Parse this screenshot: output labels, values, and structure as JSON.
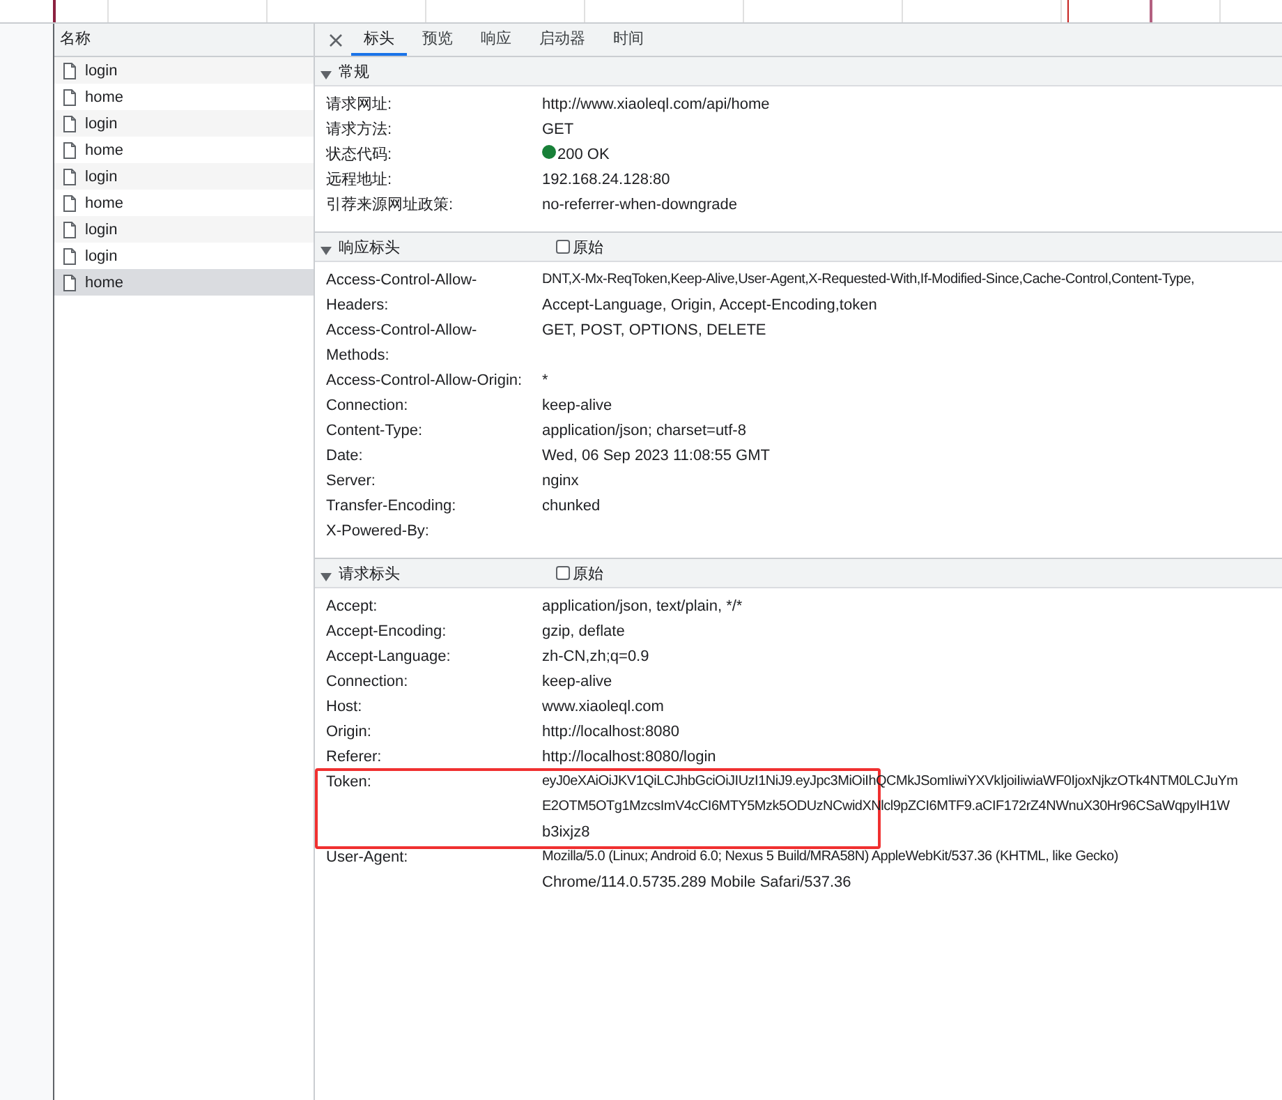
{
  "requests": {
    "header": "名称",
    "items": [
      {
        "name": "login",
        "selected": false
      },
      {
        "name": "home",
        "selected": false
      },
      {
        "name": "login",
        "selected": false
      },
      {
        "name": "home",
        "selected": false
      },
      {
        "name": "login",
        "selected": false
      },
      {
        "name": "home",
        "selected": false
      },
      {
        "name": "login",
        "selected": false
      },
      {
        "name": "login",
        "selected": false
      },
      {
        "name": "home",
        "selected": true
      }
    ]
  },
  "tabs": [
    {
      "label": "标头",
      "selected": true
    },
    {
      "label": "预览",
      "selected": false
    },
    {
      "label": "响应",
      "selected": false
    },
    {
      "label": "启动器",
      "selected": false
    },
    {
      "label": "时间",
      "selected": false
    }
  ],
  "sections": [
    {
      "title": "常规",
      "expanded": true,
      "rows": [
        {
          "name": "请求网址:",
          "lines": [
            "http://www.xiaoleql.com/api/home"
          ]
        },
        {
          "name": "请求方法:",
          "lines": [
            "GET"
          ]
        },
        {
          "name": "状态代码:",
          "lines": [
            "200 OK"
          ],
          "color": "#188038"
        },
        {
          "name": "远程地址:",
          "lines": [
            "192.168.24.128:80"
          ]
        },
        {
          "name": "引荐来源网址政策:",
          "lines": [
            "no-referrer-when-downgrade"
          ]
        }
      ]
    },
    {
      "title": "响应标头",
      "expanded": true,
      "raw": {
        "label": "原始",
        "checked": false
      },
      "rows": [
        {
          "name": "Access-Control-Allow-Headers:",
          "lines": [
            "DNT,X-Mx-ReqToken,Keep-Alive,User-Agent,X-Requested-With,If-Modified-Since,Cache-Control,Content-Type,",
            "Accept-Language, Origin, Accept-Encoding,token"
          ]
        },
        {
          "name": "Access-Control-Allow-Methods:",
          "lines": [
            "GET, POST, OPTIONS, DELETE"
          ]
        },
        {
          "name": "Access-Control-Allow-Origin:",
          "lines": [
            "*"
          ]
        },
        {
          "name": "Connection:",
          "lines": [
            "keep-alive"
          ]
        },
        {
          "name": "Content-Type:",
          "lines": [
            "application/json; charset=utf-8"
          ]
        },
        {
          "name": "Date:",
          "lines": [
            "Wed, 06 Sep 2023 11:08:55 GMT"
          ]
        },
        {
          "name": "Server:",
          "lines": [
            "nginx"
          ]
        },
        {
          "name": "Transfer-Encoding:",
          "lines": [
            "chunked"
          ]
        },
        {
          "name": "X-Powered-By:",
          "lines": []
        }
      ]
    },
    {
      "title": "请求标头",
      "expanded": true,
      "raw": {
        "label": "原始",
        "checked": false
      },
      "rows": [
        {
          "name": "Accept:",
          "lines": [
            "application/json, text/plain, */*"
          ],
          "highlighted": false
        },
        {
          "name": "Accept-Encoding:",
          "lines": [
            "gzip, deflate"
          ],
          "highlighted": false
        },
        {
          "name": "Accept-Language:",
          "lines": [
            "zh-CN,zh;q=0.9"
          ],
          "highlighted": false
        },
        {
          "name": "Connection:",
          "lines": [
            "keep-alive"
          ],
          "highlighted": false
        },
        {
          "name": "Host:",
          "lines": [
            "www.xiaoleql.com"
          ],
          "highlighted": false
        },
        {
          "name": "Origin:",
          "lines": [
            "http://localhost:8080"
          ],
          "highlighted": false
        },
        {
          "name": "Referer:",
          "lines": [
            "http://localhost:8080/login"
          ],
          "highlighted": false
        },
        {
          "name": "Token:",
          "lines": [
            "eyJ0eXAiOiJKV1QiLCJhbGciOiJIUzI1NiJ9.eyJpc3MiOiIhQCMkJSomIiwiYXVkIjoiIiwiaWF0IjoxNjkzOTk4NTM0LCJuYm",
            "E2OTM5OTg1MzcsImV4cCI6MTY5Mzk5ODUzNCwidXNlcl9pZCI6MTF9.aCIF172rZ4NWnuX30Hr96CSaWqpyIH1W",
            "b3ixjz8"
          ],
          "highlighted": true
        },
        {
          "name": "User-Agent:",
          "lines": [
            "Mozilla/5.0 (Linux; Android 6.0; Nexus 5 Build/MRA58N) AppleWebKit/537.36 (KHTML, like Gecko)",
            "Chrome/114.0.5735.289 Mobile Safari/537.36"
          ],
          "highlighted": false
        }
      ]
    }
  ]
}
